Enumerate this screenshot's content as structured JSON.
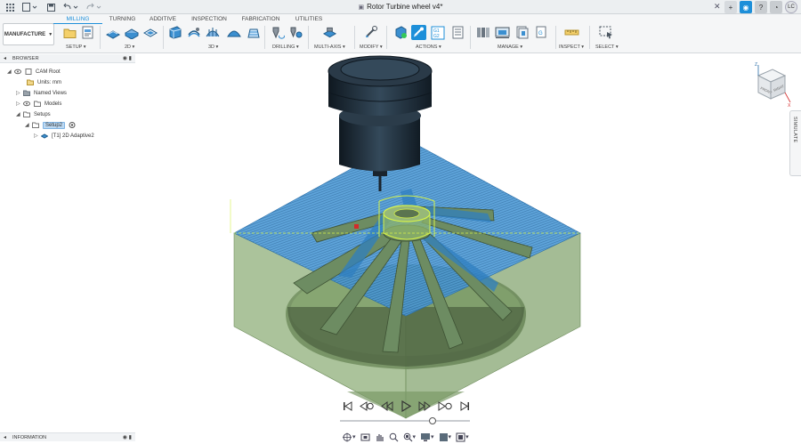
{
  "window": {
    "title": "Rotor Turbine wheel v4*"
  },
  "ribbon": {
    "workspace_label": "MANUFACTURE",
    "tabs": [
      {
        "label": "MILLING",
        "active": true
      },
      {
        "label": "TURNING",
        "active": false
      },
      {
        "label": "ADDITIVE",
        "active": false
      },
      {
        "label": "INSPECTION",
        "active": false
      },
      {
        "label": "FABRICATION",
        "active": false
      },
      {
        "label": "UTILITIES",
        "active": false
      }
    ],
    "groups": [
      {
        "label": "SETUP ▾"
      },
      {
        "label": "2D ▾"
      },
      {
        "label": "3D ▾"
      },
      {
        "label": "DRILLING ▾"
      },
      {
        "label": "MULTI-AXIS ▾"
      },
      {
        "label": "MODIFY ▾"
      },
      {
        "label": "ACTIONS ▾"
      },
      {
        "label": "MANAGE ▾"
      },
      {
        "label": "INSPECT ▾"
      },
      {
        "label": "SELECT ▾"
      }
    ],
    "g1g2_text": "G1 G2"
  },
  "browser": {
    "title": "BROWSER",
    "items": [
      {
        "label": "CAM Root"
      },
      {
        "label": "Units: mm"
      },
      {
        "label": "Named Views"
      },
      {
        "label": "Models"
      },
      {
        "label": "Setups"
      },
      {
        "label": "Setup2"
      },
      {
        "label": "[T1] 2D Adaptive2"
      }
    ]
  },
  "info_panel": {
    "title": "INFORMATION"
  },
  "side_tab": {
    "label": "SIMULATE"
  },
  "viewcube": {
    "face_left": "FRONT",
    "face_right": "RIGHT",
    "axis_z": "Z",
    "axis_x": "X"
  },
  "playback": {
    "position": 0.715
  },
  "colors": {
    "accent": "#1d8fd9",
    "stock": "#8faf7a",
    "toolpath": "#3b8fd0",
    "spindle": "#1f2b36",
    "highlight": "#d6f24a"
  }
}
